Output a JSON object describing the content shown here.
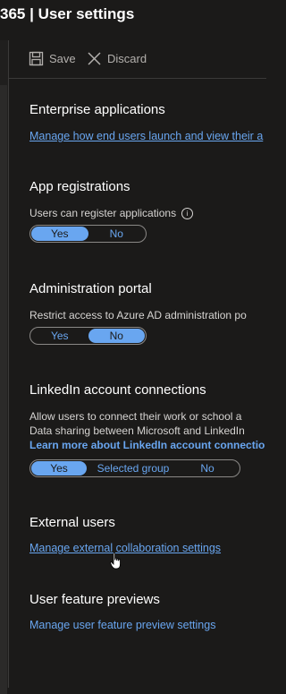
{
  "window": {
    "title": "365 | User settings"
  },
  "toolbar": {
    "save_label": "Save",
    "discard_label": "Discard"
  },
  "enterprise_apps": {
    "title": "Enterprise applications",
    "link": "Manage how end users launch and view their a"
  },
  "app_registrations": {
    "title": "App registrations",
    "setting_label": "Users can register applications",
    "options": [
      "Yes",
      "No"
    ],
    "selected": "Yes"
  },
  "admin_portal": {
    "title": "Administration portal",
    "setting_label": "Restrict access to Azure AD administration po",
    "options": [
      "Yes",
      "No"
    ],
    "selected": "No"
  },
  "linkedin": {
    "title": "LinkedIn account connections",
    "description_line1": "Allow users to connect their work or school a",
    "description_line2": "Data sharing between Microsoft and LinkedIn",
    "learn_more": "Learn more about LinkedIn account connectio",
    "options": [
      "Yes",
      "Selected group",
      "No"
    ],
    "selected": "Yes"
  },
  "external_users": {
    "title": "External users",
    "link": "Manage external collaboration settings"
  },
  "previews": {
    "title": "User feature previews",
    "link": "Manage user feature preview settings"
  },
  "colors": {
    "accent": "#69a6f0",
    "background": "#1b1a19"
  }
}
